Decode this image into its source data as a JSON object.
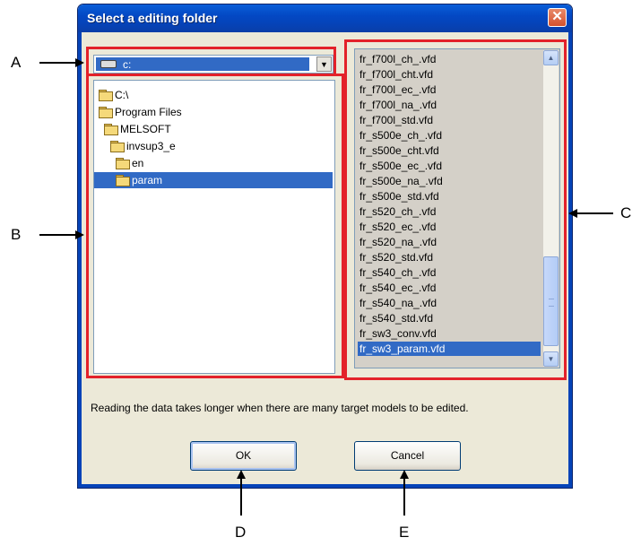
{
  "dialog": {
    "title": "Select a editing folder",
    "close_label": "✕"
  },
  "drive_combo": {
    "selected": "c:"
  },
  "folder_tree": {
    "items": [
      {
        "label": "C:\\",
        "level": 0,
        "selected": false
      },
      {
        "label": "Program Files",
        "level": 0,
        "selected": false
      },
      {
        "label": "MELSOFT",
        "level": 1,
        "selected": false
      },
      {
        "label": "invsup3_e",
        "level": 2,
        "selected": false
      },
      {
        "label": "en",
        "level": 3,
        "selected": false
      },
      {
        "label": "param",
        "level": 3,
        "selected": true
      }
    ]
  },
  "file_list": {
    "items": [
      "fr_f700l_ch_.vfd",
      "fr_f700l_cht.vfd",
      "fr_f700l_ec_.vfd",
      "fr_f700l_na_.vfd",
      "fr_f700l_std.vfd",
      "fr_s500e_ch_.vfd",
      "fr_s500e_cht.vfd",
      "fr_s500e_ec_.vfd",
      "fr_s500e_na_.vfd",
      "fr_s500e_std.vfd",
      "fr_s520_ch_.vfd",
      "fr_s520_ec_.vfd",
      "fr_s520_na_.vfd",
      "fr_s520_std.vfd",
      "fr_s540_ch_.vfd",
      "fr_s540_ec_.vfd",
      "fr_s540_na_.vfd",
      "fr_s540_std.vfd",
      "fr_sw3_conv.vfd",
      "fr_sw3_param.vfd"
    ],
    "selected_index": 19
  },
  "info_text": "Reading the data takes longer when there are many target models to be edited.",
  "buttons": {
    "ok": "OK",
    "cancel": "Cancel"
  },
  "callouts": {
    "a": "A",
    "b": "B",
    "c": "C",
    "d": "D",
    "e": "E"
  },
  "colors": {
    "selection": "#316ac5",
    "callout_box": "#e3222a",
    "title_bar": "#0543b8"
  }
}
